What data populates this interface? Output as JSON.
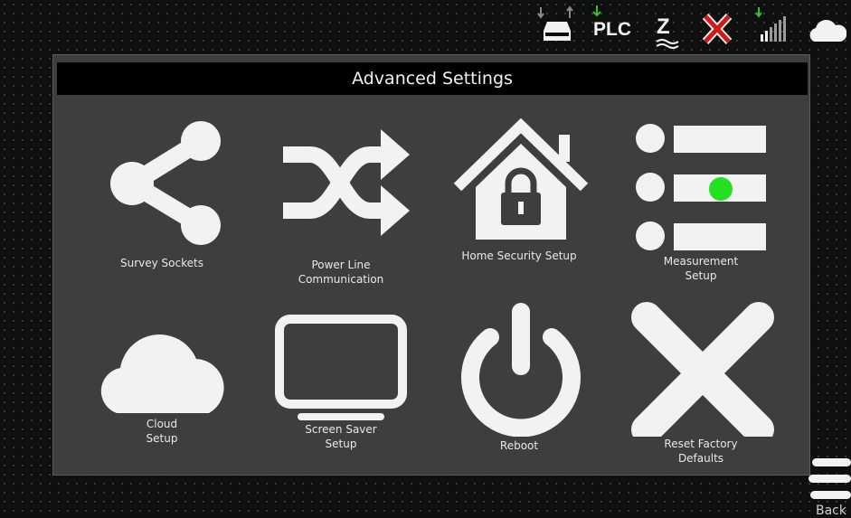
{
  "status_bar": {
    "storage_icon": "storage-drive-icon",
    "plc_label": "PLC",
    "zwave_label": "Z",
    "cellular_icon": "signal-bars-icon",
    "cloud_icon": "cloud-status-icon",
    "colors": {
      "activity_arrow": "#3bbf2a",
      "error_x": "#d11a1a",
      "icon": "#f2f2f2"
    }
  },
  "panel": {
    "title": "Advanced Settings",
    "tiles": [
      {
        "label": "Survey Sockets",
        "icon": "share-icon"
      },
      {
        "label": "Power Line\nCommunication",
        "icon": "shuffle-icon"
      },
      {
        "label": "Home Security Setup",
        "icon": "house-lock-icon"
      },
      {
        "label": "Measurement\nSetup",
        "icon": "list-icon"
      },
      {
        "label": "Cloud\nSetup",
        "icon": "cloud-icon"
      },
      {
        "label": "Screen Saver\nSetup",
        "icon": "monitor-icon"
      },
      {
        "label": "Reboot",
        "icon": "power-icon"
      },
      {
        "label": "Reset Factory\nDefaults",
        "icon": "x-icon"
      }
    ]
  },
  "back": {
    "label": "Back",
    "icon": "menu-icon"
  },
  "colors": {
    "background": "#0d100e",
    "panel": "#3e3e3e",
    "title_bar": "#000000",
    "highlight_dot": "#22e022"
  }
}
